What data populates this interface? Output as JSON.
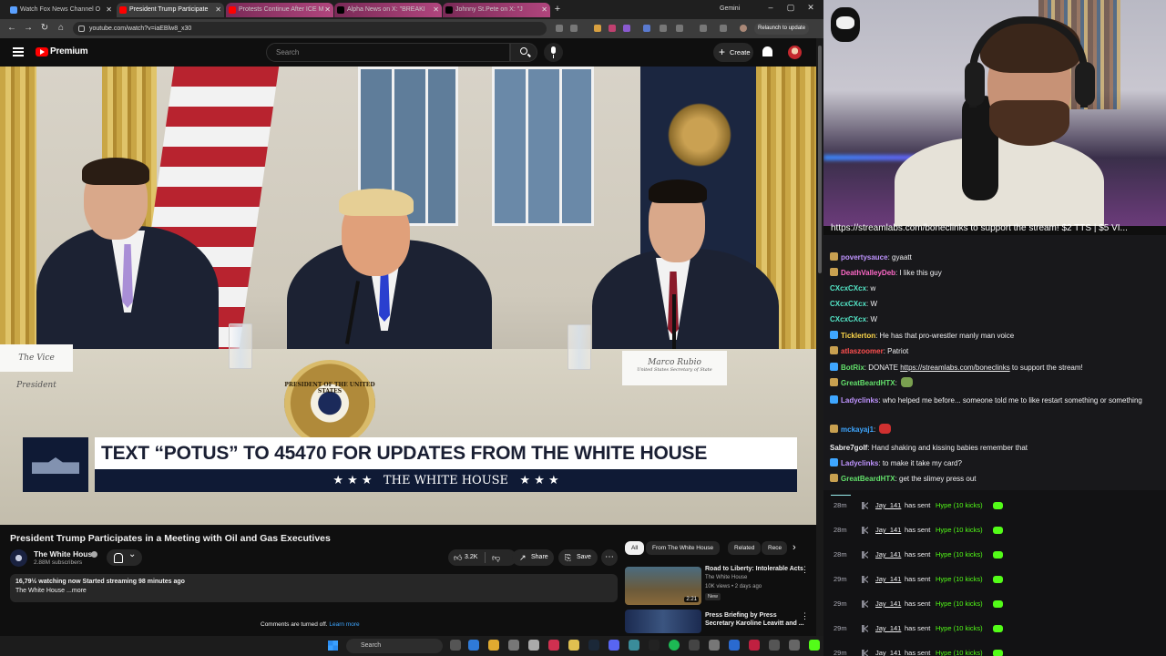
{
  "browser": {
    "tabs": [
      {
        "title": "Watch Fox News Channel O",
        "active": false
      },
      {
        "title": "President Trump Participate",
        "active": true
      },
      {
        "title": "Protests Continue After ICE M",
        "active": false
      },
      {
        "title": "Alpha News on X: \"BREAKI",
        "active": false
      },
      {
        "title": "Johnny St.Pete on X: \"J",
        "active": false
      }
    ],
    "gemini_label": "Gemini",
    "url": "youtube.com/watch?v=iaEBlw8_x30",
    "relaunch_label": "Relaunch to update"
  },
  "youtube": {
    "brand": "Premium",
    "search_placeholder": "Search",
    "create_label": "Create",
    "video": {
      "lower_third_text": "TEXT “POTUS” TO 45470 FOR UPDATES FROM THE WHITE HOUSE",
      "lower_third_sub": "★ ★ ★   THE WHITE HOUSE   ★ ★ ★",
      "nameplate_left": "The Vice President",
      "nameplate_right_name": "Marco Rubio",
      "nameplate_right_role": "United States Secretary of State",
      "seal_text": "PRESIDENT OF THE UNITED STATES"
    },
    "title": "President Trump Participates in a Meeting with Oil and Gas Executives",
    "channel": {
      "name": "The White House",
      "subscribers": "2.88M subscribers"
    },
    "actions": {
      "likes": "3.2K",
      "share": "Share",
      "save": "Save",
      "more": "⋯"
    },
    "description": {
      "line1": "16,79½ watching now  Started streaming 98 minutes ago",
      "line2": "The White House ...more"
    },
    "comments_off": "Comments are turned off.",
    "learn_more": "Learn more",
    "chips": [
      "All",
      "From The White House",
      "Related",
      "Rece"
    ],
    "related": [
      {
        "title": "Road to Liberty: Intolerable Acts",
        "channel": "The White House",
        "meta": "10K views • 2 days ago",
        "badge": "New",
        "duration": "2:21"
      },
      {
        "title": "Press Briefing by Press Secretary Karoline Leavitt and ...",
        "channel": "",
        "meta": "",
        "badge": "",
        "duration": ""
      }
    ]
  },
  "taskbar": {
    "search_placeholder": "Search"
  },
  "stream": {
    "ticker": "https://streamlabs.com/boneclinks to support the stream! $2 TTS | $5 VI..."
  },
  "chat": {
    "messages": [
      {
        "user": "povertysauce",
        "user_color": "#bf94ff",
        "text": "gyaatt"
      },
      {
        "user": "DeathValleyDeb",
        "user_color": "#ff69c8",
        "text": "I like this guy"
      },
      {
        "user": "CXcxCXcx",
        "user_color": "#54e6c7",
        "text": "w"
      },
      {
        "user": "CXcxCXcx",
        "user_color": "#54e6c7",
        "text": "W"
      },
      {
        "user": "CXcxCXcx",
        "user_color": "#54e6c7",
        "text": "W"
      },
      {
        "user": "Ticklerton",
        "user_color": "#ffd84a",
        "text": "He has that pro-wrestler manly man voice"
      },
      {
        "user": "atlaszoomer",
        "user_color": "#ff4f4f",
        "text": "Patriot"
      },
      {
        "user": "BotRix",
        "user_color": "#63e06b",
        "text": "DONATE",
        "link": "https://streamlabs.com/boneclinks",
        "text_after": "to support the stream!"
      },
      {
        "user": "GreatBeardHTX",
        "user_color": "#63e06b",
        "text": ""
      },
      {
        "user": "Ladyclinks",
        "user_color": "#bf94ff",
        "text": "who helped me before... someone told me to like restart something or something"
      },
      {
        "user": "mckayaj1",
        "user_color": "#3ea6ff",
        "text": ""
      },
      {
        "user": "Sabre7golf",
        "user_color": "#efeff1",
        "text": "Hand shaking and kissing babies remember that"
      },
      {
        "user": "Ladyclinks",
        "user_color": "#bf94ff",
        "text": "to make it take my card?"
      },
      {
        "user": "GreatBeardHTX",
        "user_color": "#63e06b",
        "text": "get the slimey press out"
      }
    ]
  },
  "events": [
    {
      "time": "28m",
      "user": "Jay_141",
      "action": "has sent",
      "gift": "Hype (10 kicks)"
    },
    {
      "time": "28m",
      "user": "Jay_141",
      "action": "has sent",
      "gift": "Hype (10 kicks)"
    },
    {
      "time": "28m",
      "user": "Jay_141",
      "action": "has sent",
      "gift": "Hype (10 kicks)"
    },
    {
      "time": "29m",
      "user": "Jay_141",
      "action": "has sent",
      "gift": "Hype (10 kicks)"
    },
    {
      "time": "29m",
      "user": "Jay_141",
      "action": "has sent",
      "gift": "Hype (10 kicks)"
    },
    {
      "time": "29m",
      "user": "Jay_141",
      "action": "has sent",
      "gift": "Hype (10 kicks)"
    },
    {
      "time": "29m",
      "user": "Jay_141",
      "action": "has sent",
      "gift": "Hype (10 kicks)"
    }
  ]
}
